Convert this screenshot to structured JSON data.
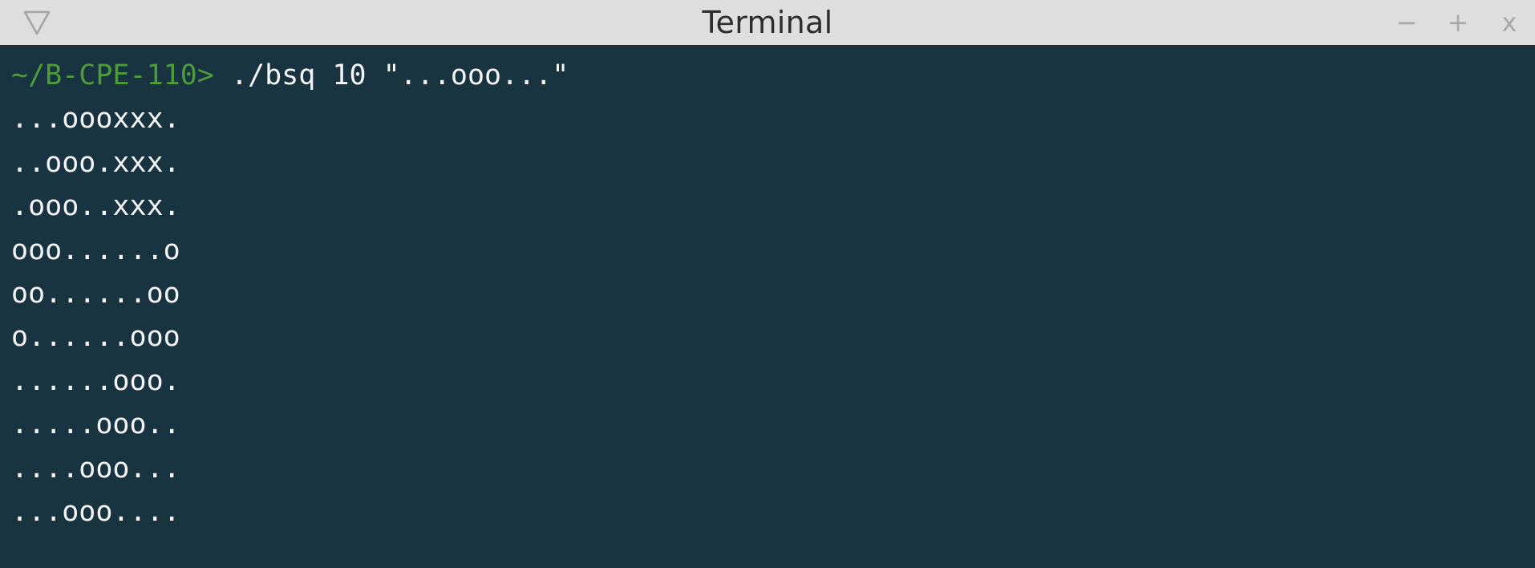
{
  "window": {
    "title": "Terminal",
    "menu_icon": "triangle-down-icon",
    "controls": {
      "minimize_label": "−",
      "maximize_label": "+",
      "close_label": "x"
    }
  },
  "terminal": {
    "prompt": "~/B-CPE-110>",
    "command": " ./bsq 10 \"...ooo...\"",
    "output": [
      "...oooxxx.",
      "..ooo.xxx.",
      ".ooo..xxx.",
      "ooo......o",
      "oo......oo",
      "o......ooo",
      "......ooo.",
      ".....ooo..",
      "....ooo...",
      "...ooo...."
    ]
  },
  "colors": {
    "background": "#183440",
    "titlebar": "#dedede",
    "prompt": "#4e9a3c",
    "text": "#f4f4f4"
  }
}
